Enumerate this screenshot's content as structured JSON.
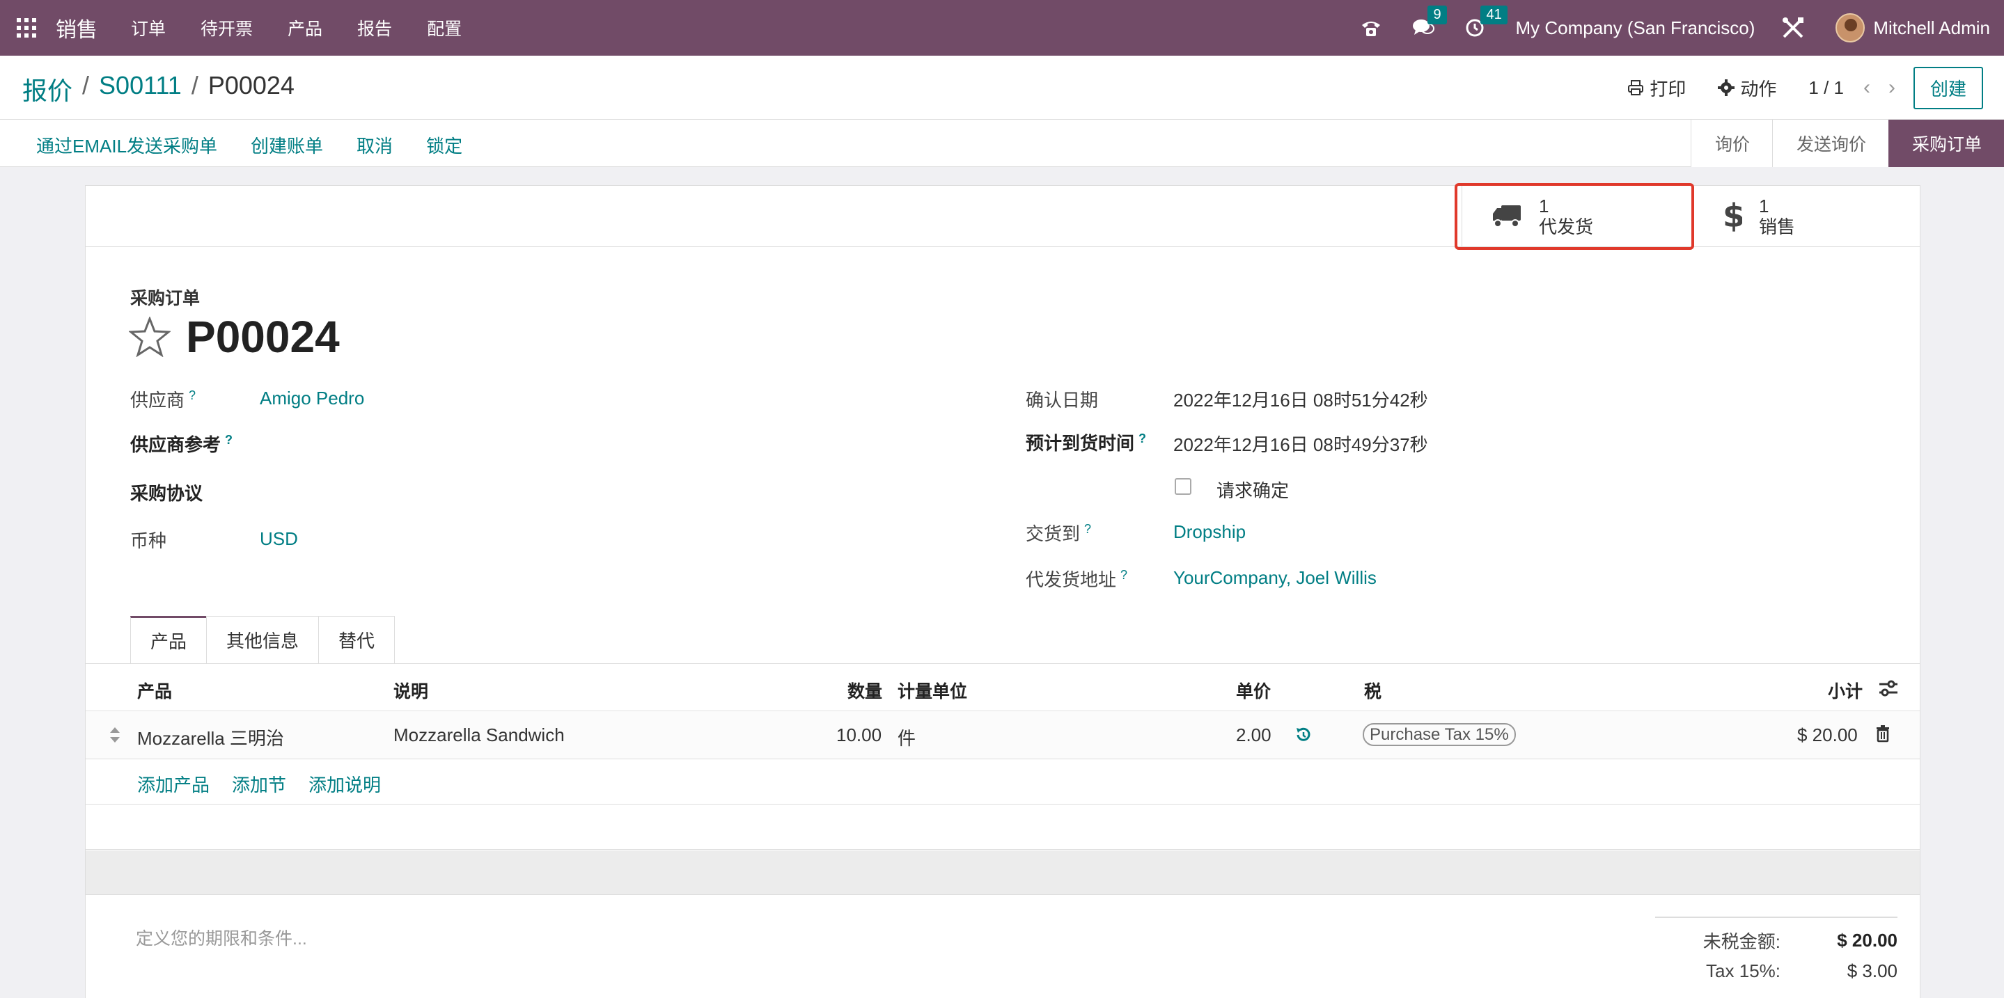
{
  "navbar": {
    "app_name": "销售",
    "menu": [
      "订单",
      "待开票",
      "产品",
      "报告",
      "配置"
    ],
    "messages_count": "9",
    "activities_count": "41",
    "company": "My Company (San Francisco)",
    "user": "Mitchell Admin"
  },
  "breadcrumb": {
    "root": "报价",
    "parent": "S00111",
    "current": "P00024"
  },
  "control": {
    "print": "打印",
    "action": "动作",
    "pager": "1 / 1",
    "create": "创建"
  },
  "statusbar": {
    "actions": [
      "通过EMAIL发送采购单",
      "创建账单",
      "取消",
      "锁定"
    ],
    "stages": [
      "询价",
      "发送询价",
      "采购订单"
    ],
    "active_stage": "采购订单"
  },
  "smart_buttons": {
    "dropship": {
      "value": "1",
      "label": "代发货"
    },
    "sales": {
      "value": "1",
      "label": "销售"
    }
  },
  "form": {
    "title_label": "采购订单",
    "name": "P00024",
    "vendor_label": "供应商",
    "vendor": "Amigo Pedro",
    "vendor_ref_label": "供应商参考",
    "agreement_label": "采购协议",
    "currency_label": "币种",
    "currency": "USD",
    "confirm_date_label": "确认日期",
    "confirm_date": "2022年12月16日 08时51分42秒",
    "expected_arrival_label": "预计到货时间",
    "expected_arrival": "2022年12月16日 08时49分37秒",
    "ask_confirm_label": "请求确定",
    "deliver_to_label": "交货到",
    "deliver_to": "Dropship",
    "dropship_address_label": "代发货地址",
    "dropship_address": "YourCompany, Joel Willis",
    "help_mark": "?"
  },
  "tabs": [
    "产品",
    "其他信息",
    "替代"
  ],
  "lines": {
    "headers": {
      "product": "产品",
      "description": "说明",
      "quantity": "数量",
      "uom": "计量单位",
      "price": "单价",
      "tax": "税",
      "subtotal": "小计"
    },
    "rows": [
      {
        "product": "Mozzarella 三明治",
        "description": "Mozzarella Sandwich",
        "quantity": "10.00",
        "uom": "件",
        "price": "2.00",
        "tax": "Purchase Tax 15%",
        "subtotal": "$ 20.00"
      }
    ],
    "add_product": "添加产品",
    "add_section": "添加节",
    "add_note": "添加说明"
  },
  "terms_placeholder": "定义您的期限和条件...",
  "totals": {
    "untaxed_label": "未税金额:",
    "untaxed": "$ 20.00",
    "tax_label": "Tax 15%:",
    "tax": "$ 3.00"
  },
  "colors": {
    "brand": "#714b67",
    "link": "#017e84",
    "highlight": "#e0392b"
  }
}
